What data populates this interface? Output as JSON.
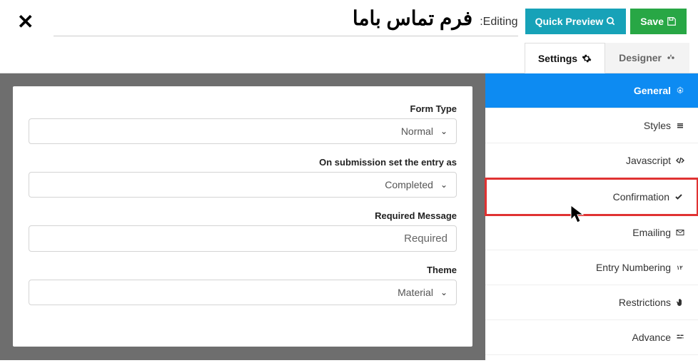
{
  "header": {
    "title": "فرم تماس باما",
    "editing_label": ":Editing",
    "preview_label": "Quick Preview",
    "save_label": "Save"
  },
  "tabs": {
    "settings": "Settings",
    "designer": "Designer"
  },
  "sidebar": [
    {
      "label": "General",
      "icon": "gear-icon",
      "active": true
    },
    {
      "label": "Styles",
      "icon": "layers-icon"
    },
    {
      "label": "Javascript",
      "icon": "code-icon"
    },
    {
      "label": "Confirmation",
      "icon": "check-icon",
      "highlight": true
    },
    {
      "label": "Emailing",
      "icon": "envelope-icon"
    },
    {
      "label": "Entry Numbering",
      "icon": "number-icon"
    },
    {
      "label": "Restrictions",
      "icon": "hand-icon"
    },
    {
      "label": "Advance",
      "icon": "sliders-icon"
    }
  ],
  "fields": {
    "form_type": {
      "label": "Form Type",
      "value": "Normal"
    },
    "submission_status": {
      "label": "On submission set the entry as",
      "value": "Completed"
    },
    "required_message": {
      "label": "Required Message",
      "value": "Required"
    },
    "theme": {
      "label": "Theme",
      "value": "Material"
    }
  }
}
